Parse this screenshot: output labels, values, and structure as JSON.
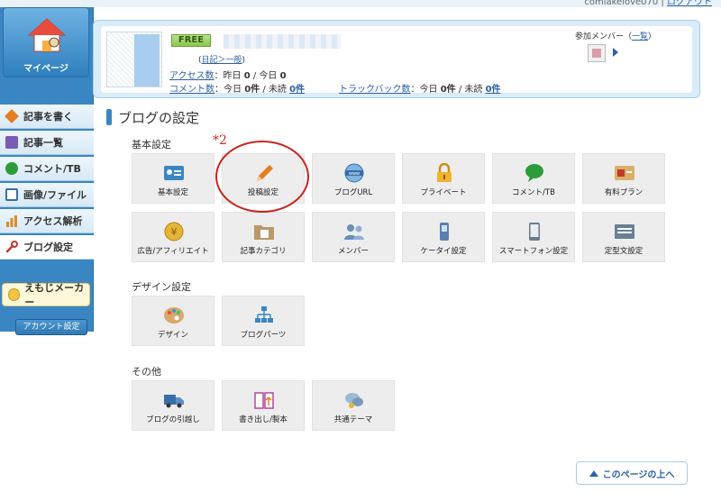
{
  "top_links": {
    "user": "comiakelove070",
    "logout": "ログアウト"
  },
  "sidebar": {
    "mypage_label": "マイページ",
    "items": [
      {
        "label": "記事を書く",
        "icon": "pencil-icon",
        "color": "#e67e22"
      },
      {
        "label": "記事一覧",
        "icon": "article-list-icon",
        "color": "#7a5bb5"
      },
      {
        "label": "コメント/TB",
        "icon": "comment-icon",
        "color": "#2e9b3b"
      },
      {
        "label": "画像/ファイル",
        "icon": "image-file-icon",
        "color": "#3a6ea8"
      },
      {
        "label": "アクセス解析",
        "icon": "bar-chart-icon",
        "color": "#e08a1e"
      },
      {
        "label": "ブログ設定",
        "icon": "wrench-icon",
        "color": "#c0392b"
      }
    ],
    "emoji_maker": "えもじメーカー",
    "account_button": "アカウント設定"
  },
  "info": {
    "badge": "FREE",
    "diary_link": "日記＞一般",
    "access_label": "アクセス数",
    "access_text_1": "：昨日 ",
    "access_yesterday": "0",
    "access_text_2": " / 今日 ",
    "access_today": "0",
    "comment_label": "コメント数",
    "comment_text_1": "：今日 ",
    "comment_today": "0件",
    "comment_text_2": " / 未読 ",
    "comment_unread": "0件",
    "trackback_label": "トラックバック数",
    "trackback_text_1": "：今日 ",
    "trackback_today": "0件",
    "trackback_text_2": " / 未読 ",
    "trackback_unread": "0件",
    "members_title_prefix": "参加メンバー（",
    "members_link": "一覧",
    "members_title_suffix": "）"
  },
  "main": {
    "title": "ブログの設定",
    "annotation": "*2",
    "sections": [
      {
        "title": "基本設定"
      },
      {
        "title": "デザイン設定"
      },
      {
        "title": "その他"
      }
    ],
    "tiles": [
      {
        "label": "基本設定",
        "icon": "id-card-icon",
        "color": "#3a86c3"
      },
      {
        "label": "投稿設定",
        "icon": "pencil-icon",
        "color": "#e67e22"
      },
      {
        "label": "ブログURL",
        "icon": "www-globe-icon",
        "color": "#3a6ea8"
      },
      {
        "label": "プライベート",
        "icon": "lock-icon",
        "color": "#e0a11b"
      },
      {
        "label": "コメント/TB",
        "icon": "comment-icon",
        "color": "#2e9b3b"
      },
      {
        "label": "有料プラン",
        "icon": "premium-card-icon",
        "color": "#c9a35a"
      },
      {
        "label": "広告/アフィリエイト",
        "icon": "yen-coin-icon",
        "color": "#d9a21c"
      },
      {
        "label": "記事カテゴリ",
        "icon": "folder-icon",
        "color": "#a88a5a"
      },
      {
        "label": "メンバー",
        "icon": "members-icon",
        "color": "#6a8fb8"
      },
      {
        "label": "ケータイ設定",
        "icon": "mobile-phone-icon",
        "color": "#5a7fb0"
      },
      {
        "label": "スマートフォン設定",
        "icon": "smartphone-icon",
        "color": "#7a8a9a"
      },
      {
        "label": "定型文設定",
        "icon": "template-text-icon",
        "color": "#6a7f96"
      },
      {
        "label": "デザイン",
        "icon": "palette-icon",
        "color": "#c8843a"
      },
      {
        "label": "ブログパーツ",
        "icon": "blog-parts-icon",
        "color": "#3a86c3"
      },
      {
        "label": "ブログの引越し",
        "icon": "moving-truck-icon",
        "color": "#3a6ea8"
      },
      {
        "label": "書き出し/製本",
        "icon": "book-export-icon",
        "color": "#b04a9a"
      },
      {
        "label": "共通テーマ",
        "icon": "common-theme-icon",
        "color": "#7a9ab8"
      }
    ],
    "to_top": "このページの上へ"
  }
}
